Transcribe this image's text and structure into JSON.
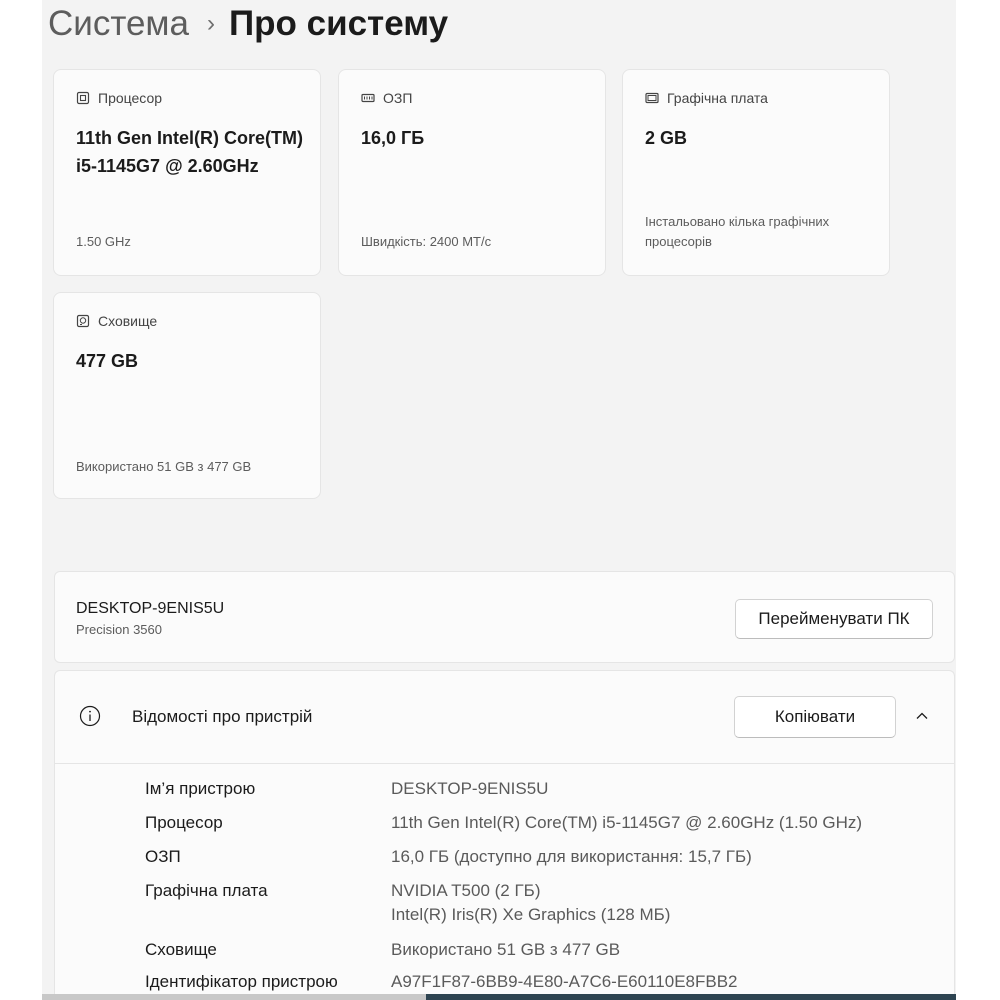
{
  "header": {
    "parent": "Система",
    "separator": "›",
    "current": "Про систему"
  },
  "specs_cards": [
    {
      "icon": "cpu-icon",
      "label": "Процесор",
      "value": "11th Gen Intel(R) Core(TM) i5-1145G7 @ 2.60GHz",
      "sub": "1.50 GHz"
    },
    {
      "icon": "ram-icon",
      "label": "ОЗП",
      "value": "16,0 ГБ",
      "sub": "Швидкість: 2400 MT/с"
    },
    {
      "icon": "gpu-icon",
      "label": "Графічна плата",
      "value": "2 GB",
      "sub": "Інстальовано кілька графічних процесорів"
    },
    {
      "icon": "storage-icon",
      "label": "Сховище",
      "value": "477 GB",
      "sub": "Використано 51 GB з 477 GB"
    }
  ],
  "device": {
    "name": "DESKTOP-9ENIS5U",
    "model": "Precision 3560",
    "rename_button": "Перейменувати ПК"
  },
  "device_info": {
    "title": "Відомості про пристрій",
    "copy_button": "Копіювати",
    "rows": [
      {
        "key": "Ім’я пристрою",
        "value": "DESKTOP-9ENIS5U"
      },
      {
        "key": "Процесор",
        "value": "11th Gen Intel(R) Core(TM) i5-1145G7 @ 2.60GHz (1.50 GHz)"
      },
      {
        "key": "ОЗП",
        "value": "16,0 ГБ (доступно для використання: 15,7 ГБ)"
      },
      {
        "key": "Графічна плата",
        "value": "NVIDIA T500 (2 ГБ)",
        "value2": "Intel(R) Iris(R) Xe Graphics (128 МБ)"
      },
      {
        "key": "Сховище",
        "value": "Використано 51 GB з 477 GB"
      },
      {
        "key": "Ідентифікатор пристрою",
        "value": "A97F1F87-6BB9-4E80-A7C6-E60110E8FBB2"
      }
    ]
  },
  "colors": {
    "background": "#f3f3f3",
    "card": "#fbfbfb",
    "scroll_thumb": "#2e4451"
  }
}
